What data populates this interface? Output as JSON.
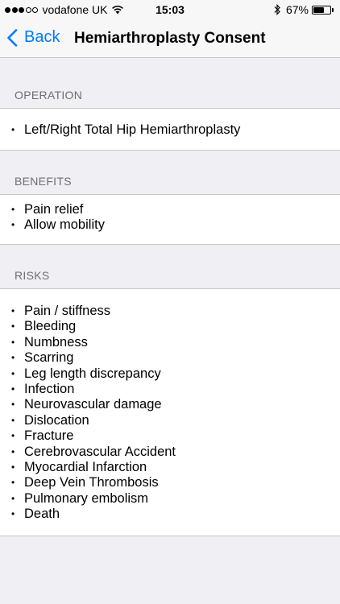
{
  "status_bar": {
    "carrier": "vodafone UK",
    "time": "15:03",
    "battery_percent": "67%",
    "signal_strength": 3,
    "battery_level": 0.67
  },
  "nav": {
    "back_label": "Back",
    "title": "Hemiarthroplasty Consent"
  },
  "sections": {
    "operation": {
      "header": "OPERATION",
      "items": [
        "Left/Right Total Hip Hemiarthroplasty"
      ]
    },
    "benefits": {
      "header": "BENEFITS",
      "items": [
        "Pain relief",
        "Allow mobility"
      ]
    },
    "risks": {
      "header": "RISKS",
      "items": [
        "Pain / stiffness",
        "Bleeding",
        "Numbness",
        "Scarring",
        "Leg length discrepancy",
        "Infection",
        "Neurovascular damage",
        "Dislocation",
        "Fracture",
        "Cerebrovascular Accident",
        "Myocardial Infarction",
        "Deep Vein Thrombosis",
        "Pulmonary embolism",
        "Death"
      ]
    }
  },
  "colors": {
    "accent": "#007aff",
    "background": "#efeff4",
    "section_header_text": "#6d6d72"
  }
}
